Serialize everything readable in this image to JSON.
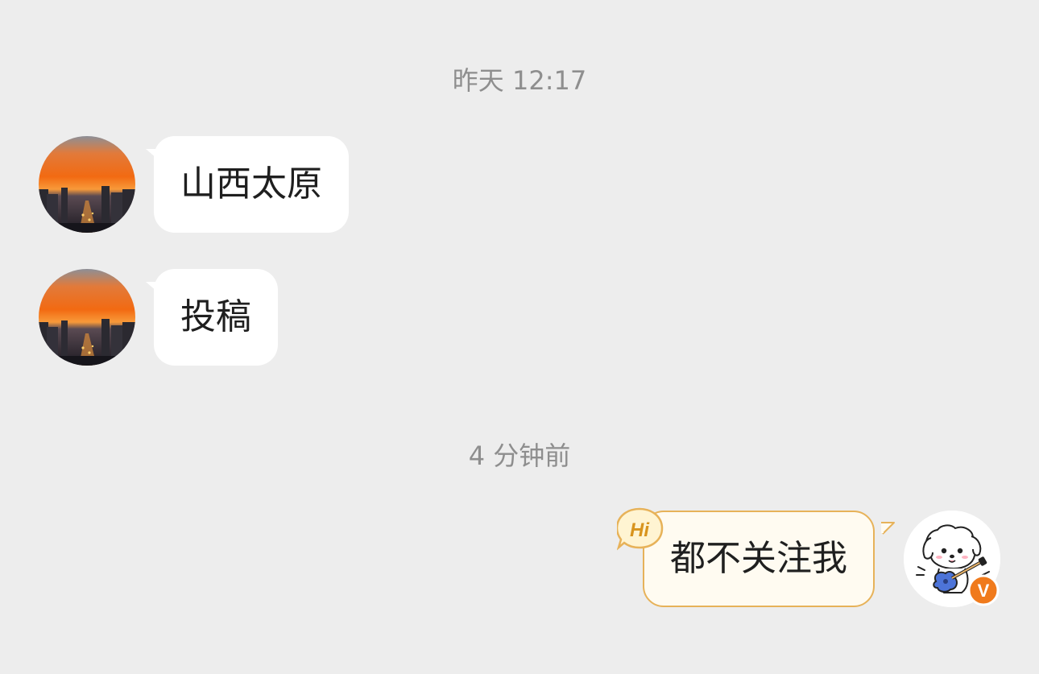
{
  "timestamps": {
    "first": "昨天 12:17",
    "second": "4 分钟前"
  },
  "messages": {
    "incoming": [
      {
        "text": "山西太原",
        "avatar": "sunset-city-avatar"
      },
      {
        "text": "投稿",
        "avatar": "sunset-city-avatar"
      }
    ],
    "outgoing": [
      {
        "text": "都不关注我",
        "badge": "Hi",
        "avatar": "puppy-guitar-avatar"
      }
    ]
  },
  "badges": {
    "hi_label": "Hi",
    "verified_label": "V"
  },
  "colors": {
    "background": "#ededed",
    "incoming_bubble": "#ffffff",
    "outgoing_bubble": "#fffbf1",
    "outgoing_border": "#e7b259",
    "verified_badge": "#f07a1c",
    "timestamp_text": "#8e8e8e"
  }
}
